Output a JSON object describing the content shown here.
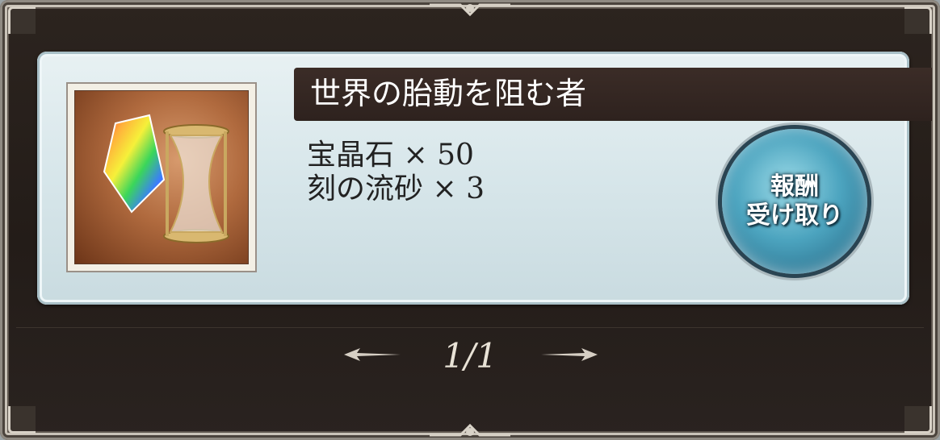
{
  "mission": {
    "title": "世界の胎動を阻む者",
    "rewards": [
      {
        "name": "宝晶石",
        "quantity": "× 50"
      },
      {
        "name": "刻の流砂",
        "quantity": "× 3"
      }
    ],
    "icon": "crystal-and-hourglass-icon"
  },
  "claim_button": {
    "line1": "報酬",
    "line2": "受け取り"
  },
  "pager": {
    "indicator": "1/1",
    "prev_icon": "arrow-left-icon",
    "next_icon": "arrow-right-icon"
  },
  "colors": {
    "frame": "#231c18",
    "title_bar": "#2e221e",
    "card": "#d7e6ea",
    "button": "#4ca4bf"
  }
}
